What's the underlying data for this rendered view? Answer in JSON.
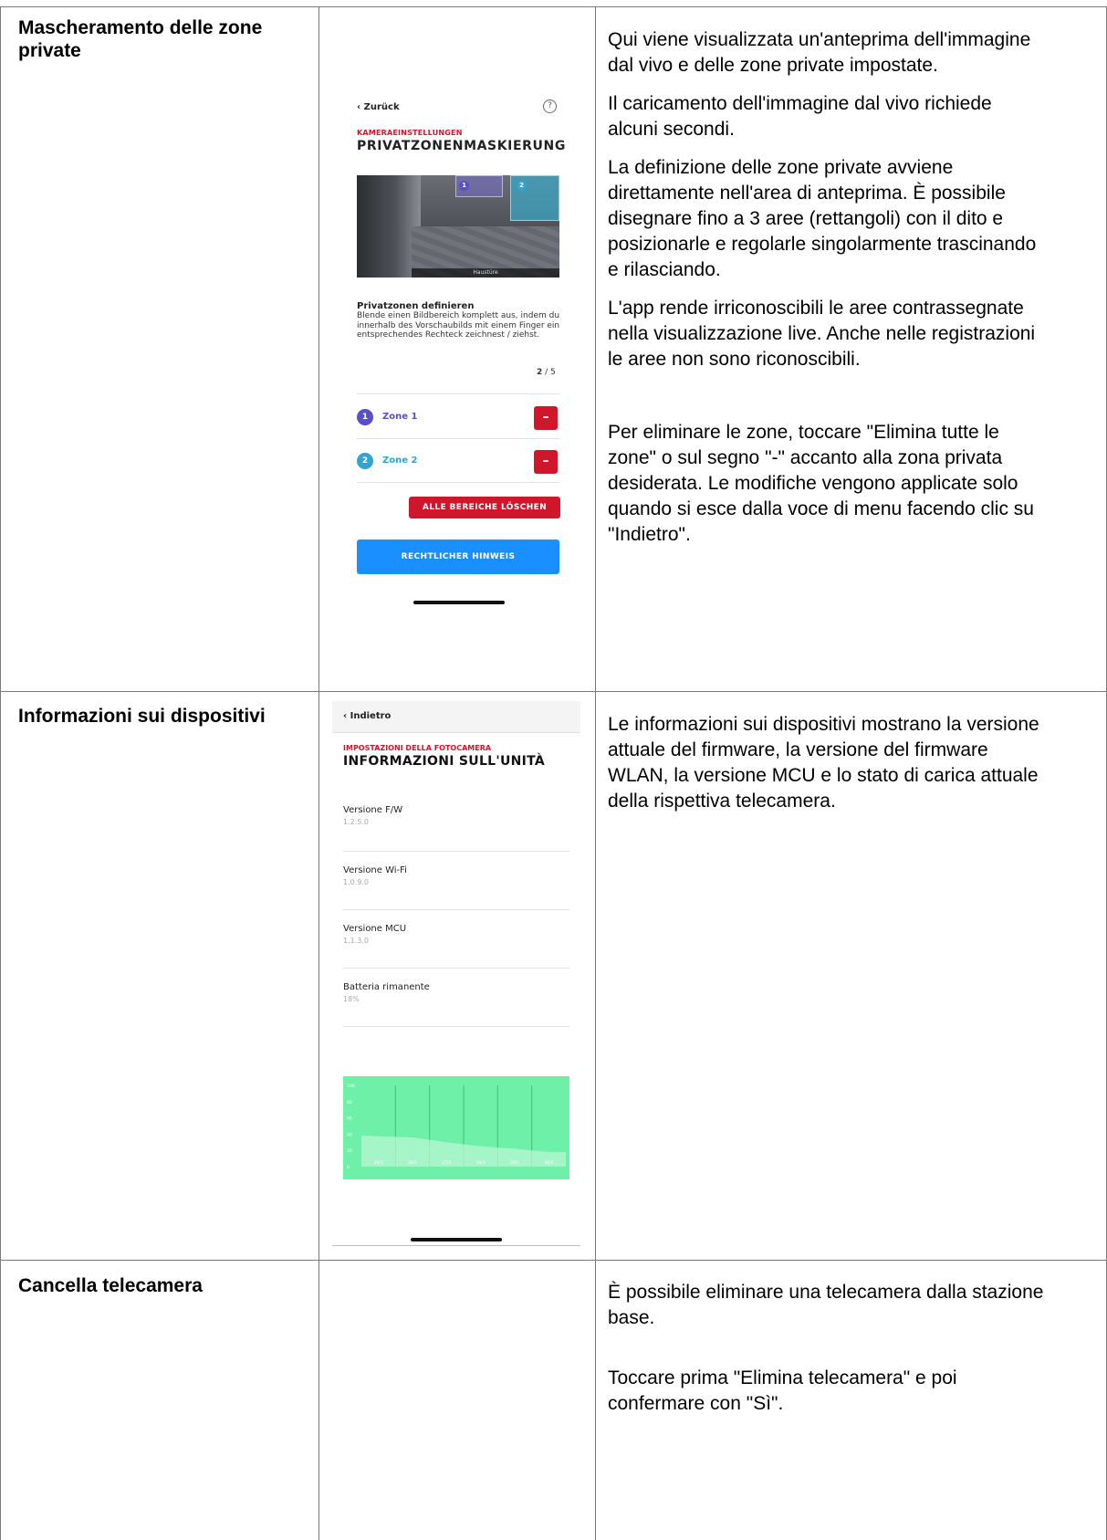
{
  "rows": [
    {
      "title": "Mascheramento delle zone private",
      "paragraphs": [
        "Qui viene visualizzata un'anteprima dell'immagine dal vivo e delle zone private impostate.",
        "Il caricamento dell'immagine dal vivo richiede alcuni secondi.",
        "La definizione delle zone private avviene direttamente nell'area di anteprima. È possibile disegnare fino a 3 aree (rettangoli) con il dito e posizionarle e regolarle singolarmente trascinando e rilasciando.",
        "L'app rende irriconoscibili le aree contrassegnate nella visualizzazione live. Anche nelle registrazioni le aree non sono riconoscibili.",
        "Per eliminare le zone, toccare \"Elimina tutte le zone\" o sul segno \"-\" accanto alla zona privata desiderata. Le modifiche vengono applicate solo quando si esce dalla voce di menu facendo clic su \"Indietro\"."
      ]
    },
    {
      "title": "Informazioni sui dispositivi",
      "paragraphs": [
        "Le informazioni sui dispositivi mostrano la versione attuale del firmware, la versione del firmware WLAN, la versione MCU e lo stato di carica attuale della rispettiva telecamera."
      ]
    },
    {
      "title": "Cancella telecamera",
      "paragraphs": [
        "È possibile eliminare una telecamera dalla stazione base.",
        "Toccare prima \"Elimina telecamera\" e poi confermare con \"Sì\"."
      ]
    }
  ],
  "screen1": {
    "back_label": "Zurück",
    "help_icon": "?",
    "kicker": "KAMERAEINSTELLUNGEN",
    "title": "PRIVATZONENMASKIERUNG",
    "preview_caption": "Haustüre",
    "subhead": "Privatzonen definieren",
    "instructions": "Blende einen Bildbereich komplett aus, indem du innerhalb des Vorschaubilds mit einem Finger ein entsprechendes Rechteck zeichnest / ziehst.",
    "counter_current": "2",
    "counter_total": "/ 5",
    "zones": [
      {
        "number": "1",
        "label": "Zone 1",
        "color": "#5a4fc8",
        "remove": "–"
      },
      {
        "number": "2",
        "label": "Zone 2",
        "color": "#33a3d2",
        "remove": "–"
      }
    ],
    "delete_all_label": "ALLE BEREICHE LÖSCHEN",
    "legal_label": "RECHTLICHER HINWEIS"
  },
  "screen2": {
    "back_label": "Indietro",
    "kicker": "IMPOSTAZIONI DELLA FOTOCAMERA",
    "title": "INFORMAZIONI SULL'UNITÀ",
    "items": [
      {
        "label": "Versione F/W",
        "value": "1.2.5.0"
      },
      {
        "label": "Versione Wi-Fi",
        "value": "1.0.9.0"
      },
      {
        "label": "Versione MCU",
        "value": "1.1.3.0"
      },
      {
        "label": "Batteria rimanente",
        "value": "18%"
      }
    ]
  },
  "chart_data": {
    "type": "area",
    "y_ticks": [
      "100",
      "80",
      "60",
      "40",
      "20",
      "0"
    ],
    "ylim": [
      0,
      100
    ],
    "categories": [
      "20/5",
      "26/5",
      "27/5",
      "28/5",
      "29/5",
      "30/5"
    ],
    "values": [
      38,
      36,
      30,
      25,
      22,
      18
    ],
    "grid": true,
    "background": "#6ef0a8",
    "fill": "#b8f7d3"
  },
  "colors": {
    "accent_red": "#d0162b",
    "accent_blue": "#1a8fff"
  }
}
